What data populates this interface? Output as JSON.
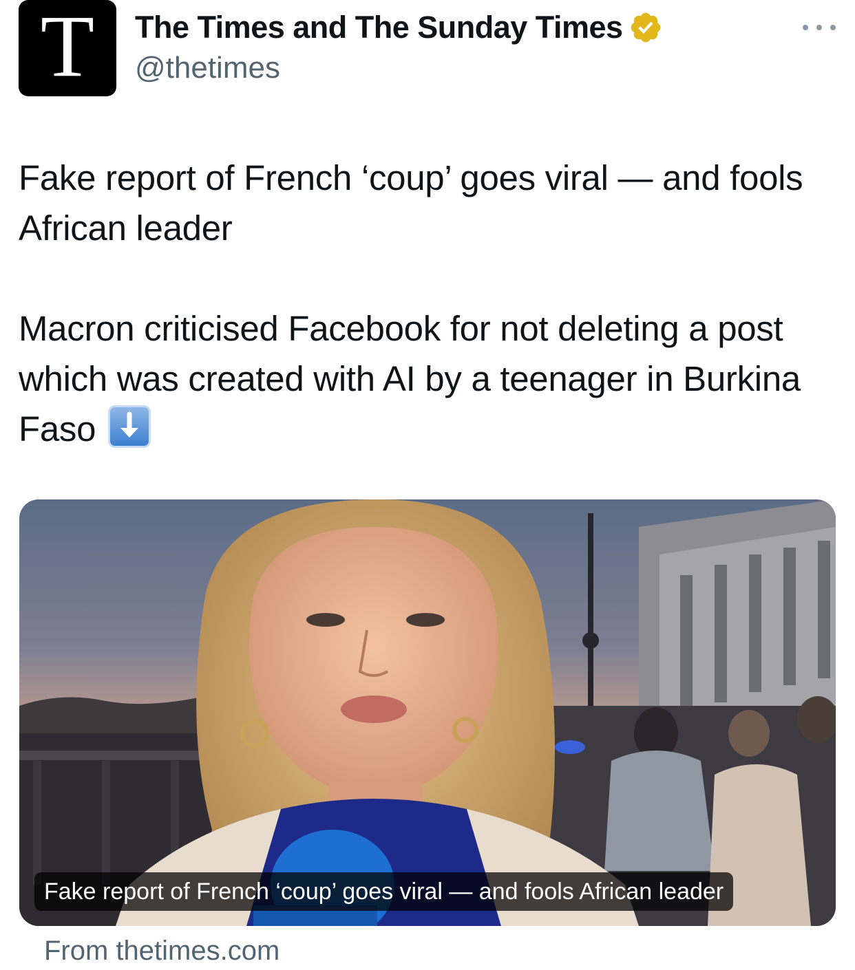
{
  "author": {
    "avatar_letter": "T",
    "name": "The Times and The Sunday Times",
    "handle": "@thetimes",
    "verified_color": "#E2B719"
  },
  "tweet": {
    "paragraph_1": "Fake report of French ‘coup’ goes viral — and fools African leader",
    "paragraph_2": "Macron criticised Facebook for not deleting a post which was created with AI by a teenager in Burkina Faso",
    "emoji": "down-arrow-emoji"
  },
  "card": {
    "caption": "Fake report of French ‘coup’ goes viral — and fools African leader",
    "source": "From thetimes.com"
  },
  "icons": {
    "more": "more-horizontal-icon",
    "verified": "verified-badge-icon"
  }
}
